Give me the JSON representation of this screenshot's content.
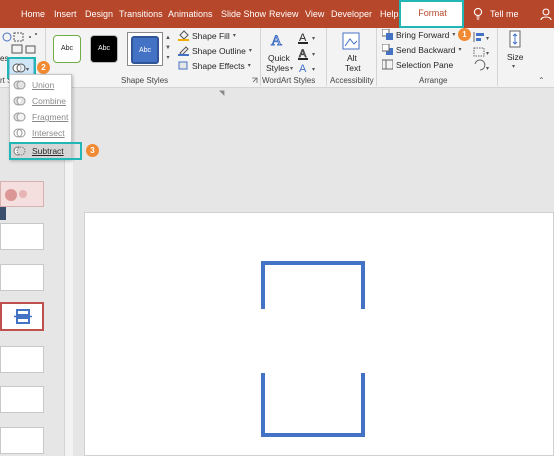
{
  "tabs": [
    "Home",
    "Insert",
    "Design",
    "Transitions",
    "Animations",
    "Slide Show",
    "Review",
    "View",
    "Developer",
    "Help"
  ],
  "active_tab": "Format",
  "tell_me": "Tell me",
  "ribbon": {
    "style_swatches": [
      "Abc",
      "Abc",
      "Abc"
    ],
    "shape_fill": "Shape Fill",
    "shape_outline": "Shape Outline",
    "shape_effects": "Shape Effects",
    "shape_styles_label": "Shape Styles",
    "quick_styles_line1": "Quick",
    "quick_styles_line2": "Styles",
    "wordart_label": "WordArt Styles",
    "alt_text_line1": "Alt",
    "alt_text_line2": "Text",
    "accessibility_label": "Accessibility",
    "bring_forward": "Bring Forward",
    "send_backward": "Send Backward",
    "selection_pane": "Selection Pane",
    "arrange_label": "Arrange",
    "size_label": "Size",
    "insert_shapes_fragment": "es",
    "insert_shapes_label_fragment": "rt S"
  },
  "merge_menu": {
    "items": [
      "Union",
      "Combine",
      "Fragment",
      "Intersect",
      "Subtract"
    ],
    "selected": "Subtract"
  },
  "badges": [
    "1",
    "2",
    "3"
  ],
  "colors": {
    "ribbon_red": "#b7472a",
    "highlight_teal": "#21b7b7",
    "badge_orange": "#f28a34",
    "shape_blue": "#4472c4",
    "selected_thumb_border": "#c0504d"
  }
}
